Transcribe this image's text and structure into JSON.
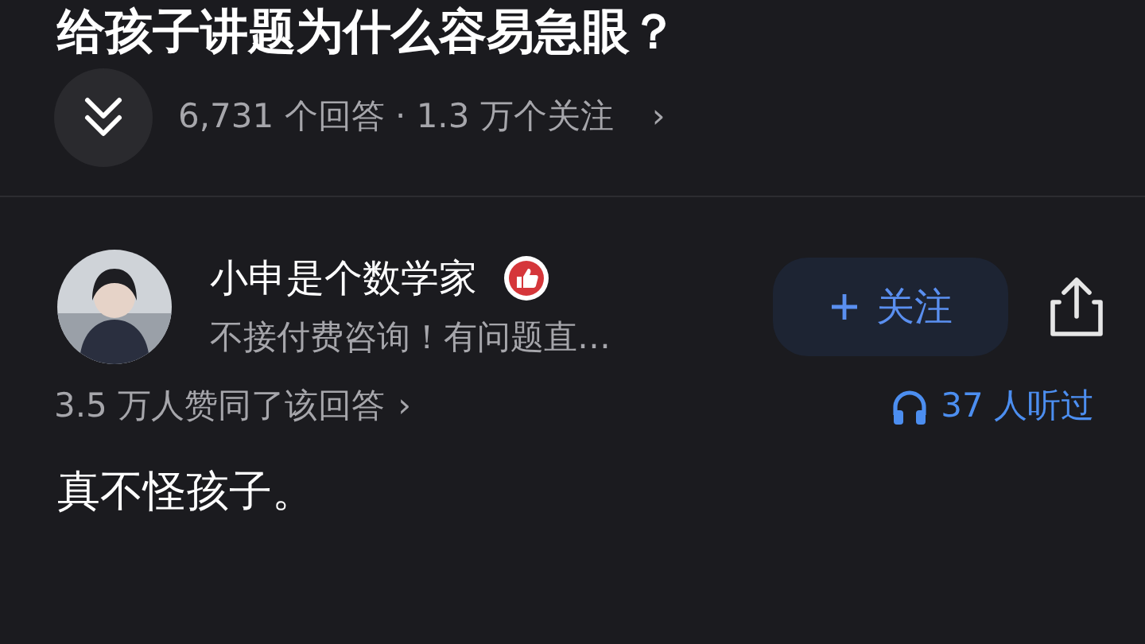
{
  "question": {
    "title": "给孩子讲题为什么容易急眼？",
    "stats": "6,731 个回答 · 1.3 万个关注",
    "stats_chevron": "›"
  },
  "author": {
    "name": "小申是个数学家",
    "verified": true,
    "bio": "不接付费咨询！有问题直…",
    "follow_button": "关注"
  },
  "answer": {
    "upvotes": "3.5 万人赞同了该回答",
    "upvotes_chevron": "›",
    "listens": "37 人听过",
    "first_line": "真不怪孩子。"
  }
}
